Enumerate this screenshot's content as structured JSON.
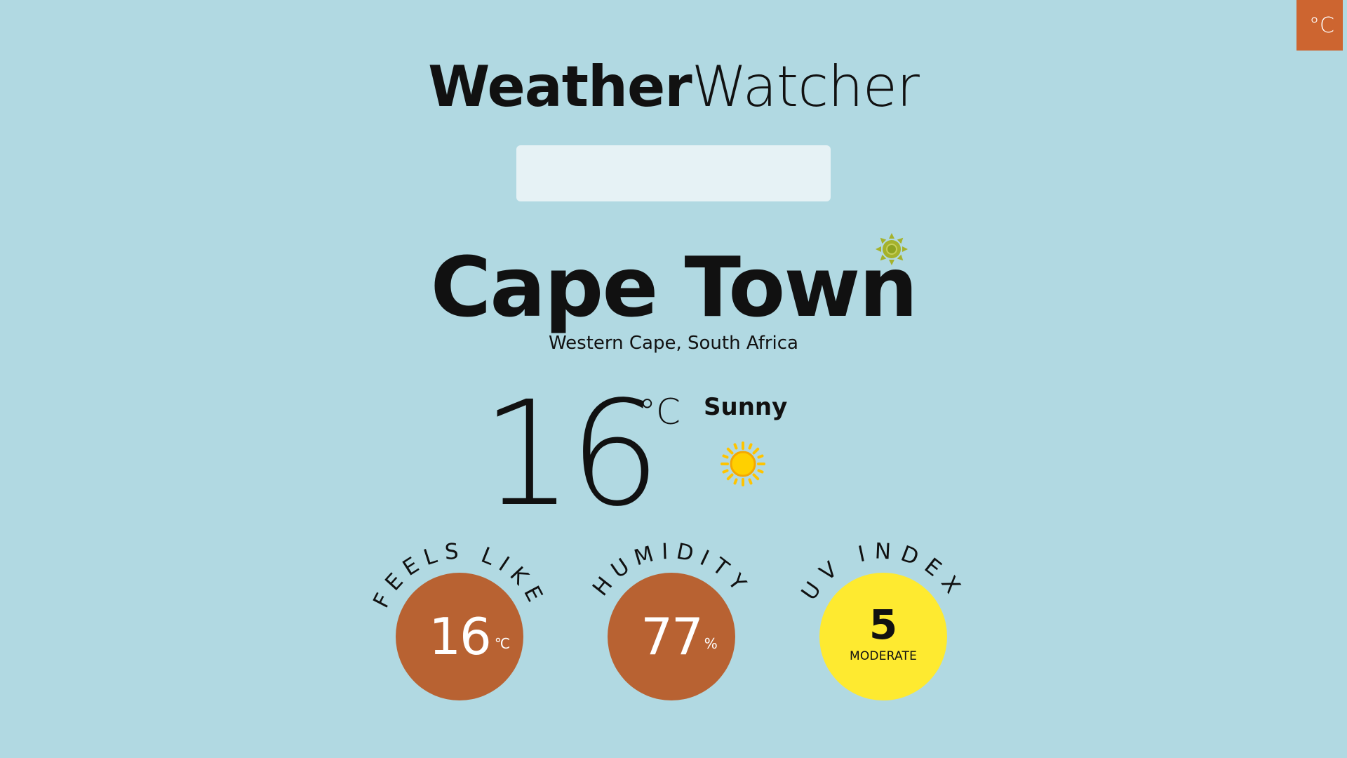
{
  "header": {
    "unit_toggle_label": "°C",
    "title_bold": "Weather",
    "title_light": "Watcher"
  },
  "search": {
    "value": "",
    "placeholder": ""
  },
  "location": {
    "city": "Cape Town",
    "region": "Western Cape, South Africa",
    "badge_icon": "sun-badge-icon"
  },
  "current": {
    "temperature": "16",
    "unit": "°C",
    "condition": "Sunny",
    "condition_icon": "sun-icon"
  },
  "stats": {
    "feels_like": {
      "label": "FEELS LIKE",
      "value": "16",
      "unit": "°C"
    },
    "humidity": {
      "label": "HUMIDITY",
      "value": "77",
      "unit": "%"
    },
    "uv_index": {
      "label": "UV INDEX",
      "value": "5",
      "level": "MODERATE"
    }
  },
  "colors": {
    "background": "#b1d9e2",
    "accent": "#cd6530",
    "stat_circle": "#b86232",
    "uv_circle": "#feea30",
    "sun_yellow": "#ffd000",
    "sun_badge": "#a5b22c"
  }
}
